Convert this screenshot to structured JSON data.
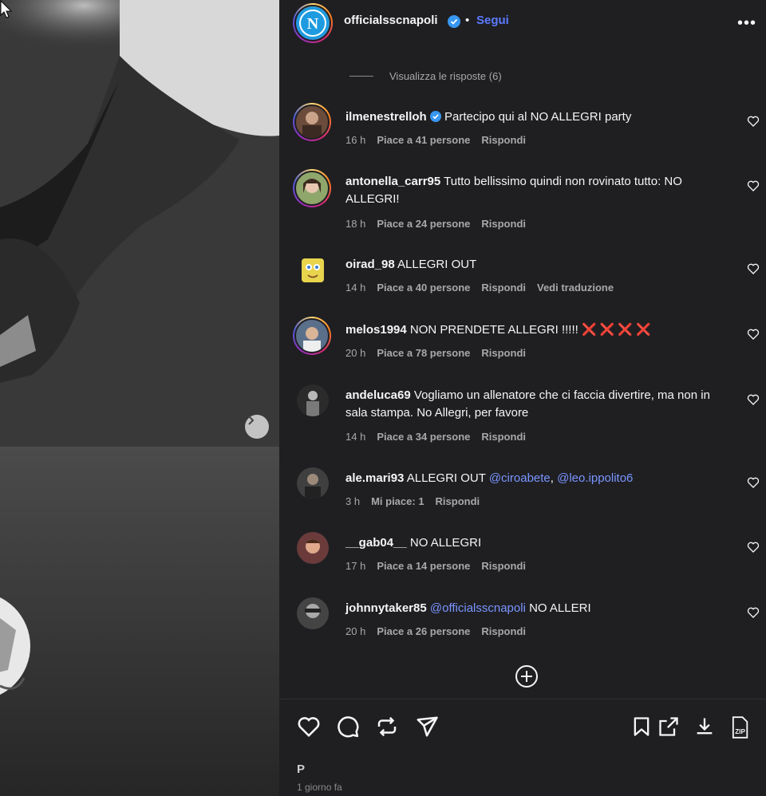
{
  "header": {
    "username": "officialsscnapoli",
    "separator": "•",
    "follow_label": "Segui",
    "more_label": "•••"
  },
  "view_replies_label": "Visualizza le risposte (6)",
  "comments": [
    {
      "user": "ilmenestrelloh",
      "verified": true,
      "text": "Partecipo qui al NO ALLEGRI party",
      "time": "16 h",
      "likes": "Piace a 41 persone",
      "reply": "Rispondi",
      "translate": ""
    },
    {
      "user": "antonella_carr95",
      "verified": false,
      "text": "Tutto bellissimo quindi non rovinato tutto: NO ALLEGRI!",
      "time": "18 h",
      "likes": "Piace a 24 persone",
      "reply": "Rispondi",
      "translate": ""
    },
    {
      "user": "oirad_98",
      "verified": false,
      "text": "ALLEGRI OUT",
      "time": "14 h",
      "likes": "Piace a 40 persone",
      "reply": "Rispondi",
      "translate": "Vedi traduzione"
    },
    {
      "user": "melos1994",
      "verified": false,
      "text": "NON PRENDETE ALLEGRI !!!!!",
      "emoji": "❌❌❌❌",
      "time": "20 h",
      "likes": "Piace a 78 persone",
      "reply": "Rispondi",
      "translate": ""
    },
    {
      "user": "andeluca69",
      "verified": false,
      "text": "Vogliamo un allenatore che ci faccia divertire, ma non in sala stampa. No Allegri, per favore",
      "time": "14 h",
      "likes": "Piace a 34 persone",
      "reply": "Rispondi",
      "translate": ""
    },
    {
      "user": "ale.mari93",
      "verified": false,
      "text": "ALLEGRI OUT",
      "mention1": "@ciroabete",
      "comma": ",",
      "mention2": "@leo.ippolito6",
      "time": "3 h",
      "likes": "Mi piace: 1",
      "reply": "Rispondi",
      "translate": ""
    },
    {
      "user": "__gab04__",
      "verified": false,
      "text": "NO ALLEGRI",
      "time": "17 h",
      "likes": "Piace a 14 persone",
      "reply": "Rispondi",
      "translate": ""
    },
    {
      "user": "johnnytaker85",
      "verified": false,
      "mention1": "@officialsscnapoli",
      "text": "NO ALLERI",
      "time": "20 h",
      "likes": "Piace a 26 persone",
      "reply": "Rispondi",
      "translate": ""
    }
  ],
  "footer": {
    "likes_partial": "P",
    "date_partial": "1 giorno fa"
  },
  "icons": {
    "like": "heart-icon",
    "comment": "comment-bubble-icon",
    "repost": "repost-icon",
    "share": "send-icon",
    "save": "bookmark-icon",
    "open": "external-link-icon",
    "download": "download-icon",
    "zip": "zip-icon",
    "add": "plus-circle-icon"
  },
  "colors": {
    "panel_bg": "#1f1f22",
    "accent_link": "#5b7bff",
    "mention": "#7a95ff",
    "verified": "#3897f0",
    "muted": "#a8a8a8",
    "cross_red": "#e0245e"
  }
}
